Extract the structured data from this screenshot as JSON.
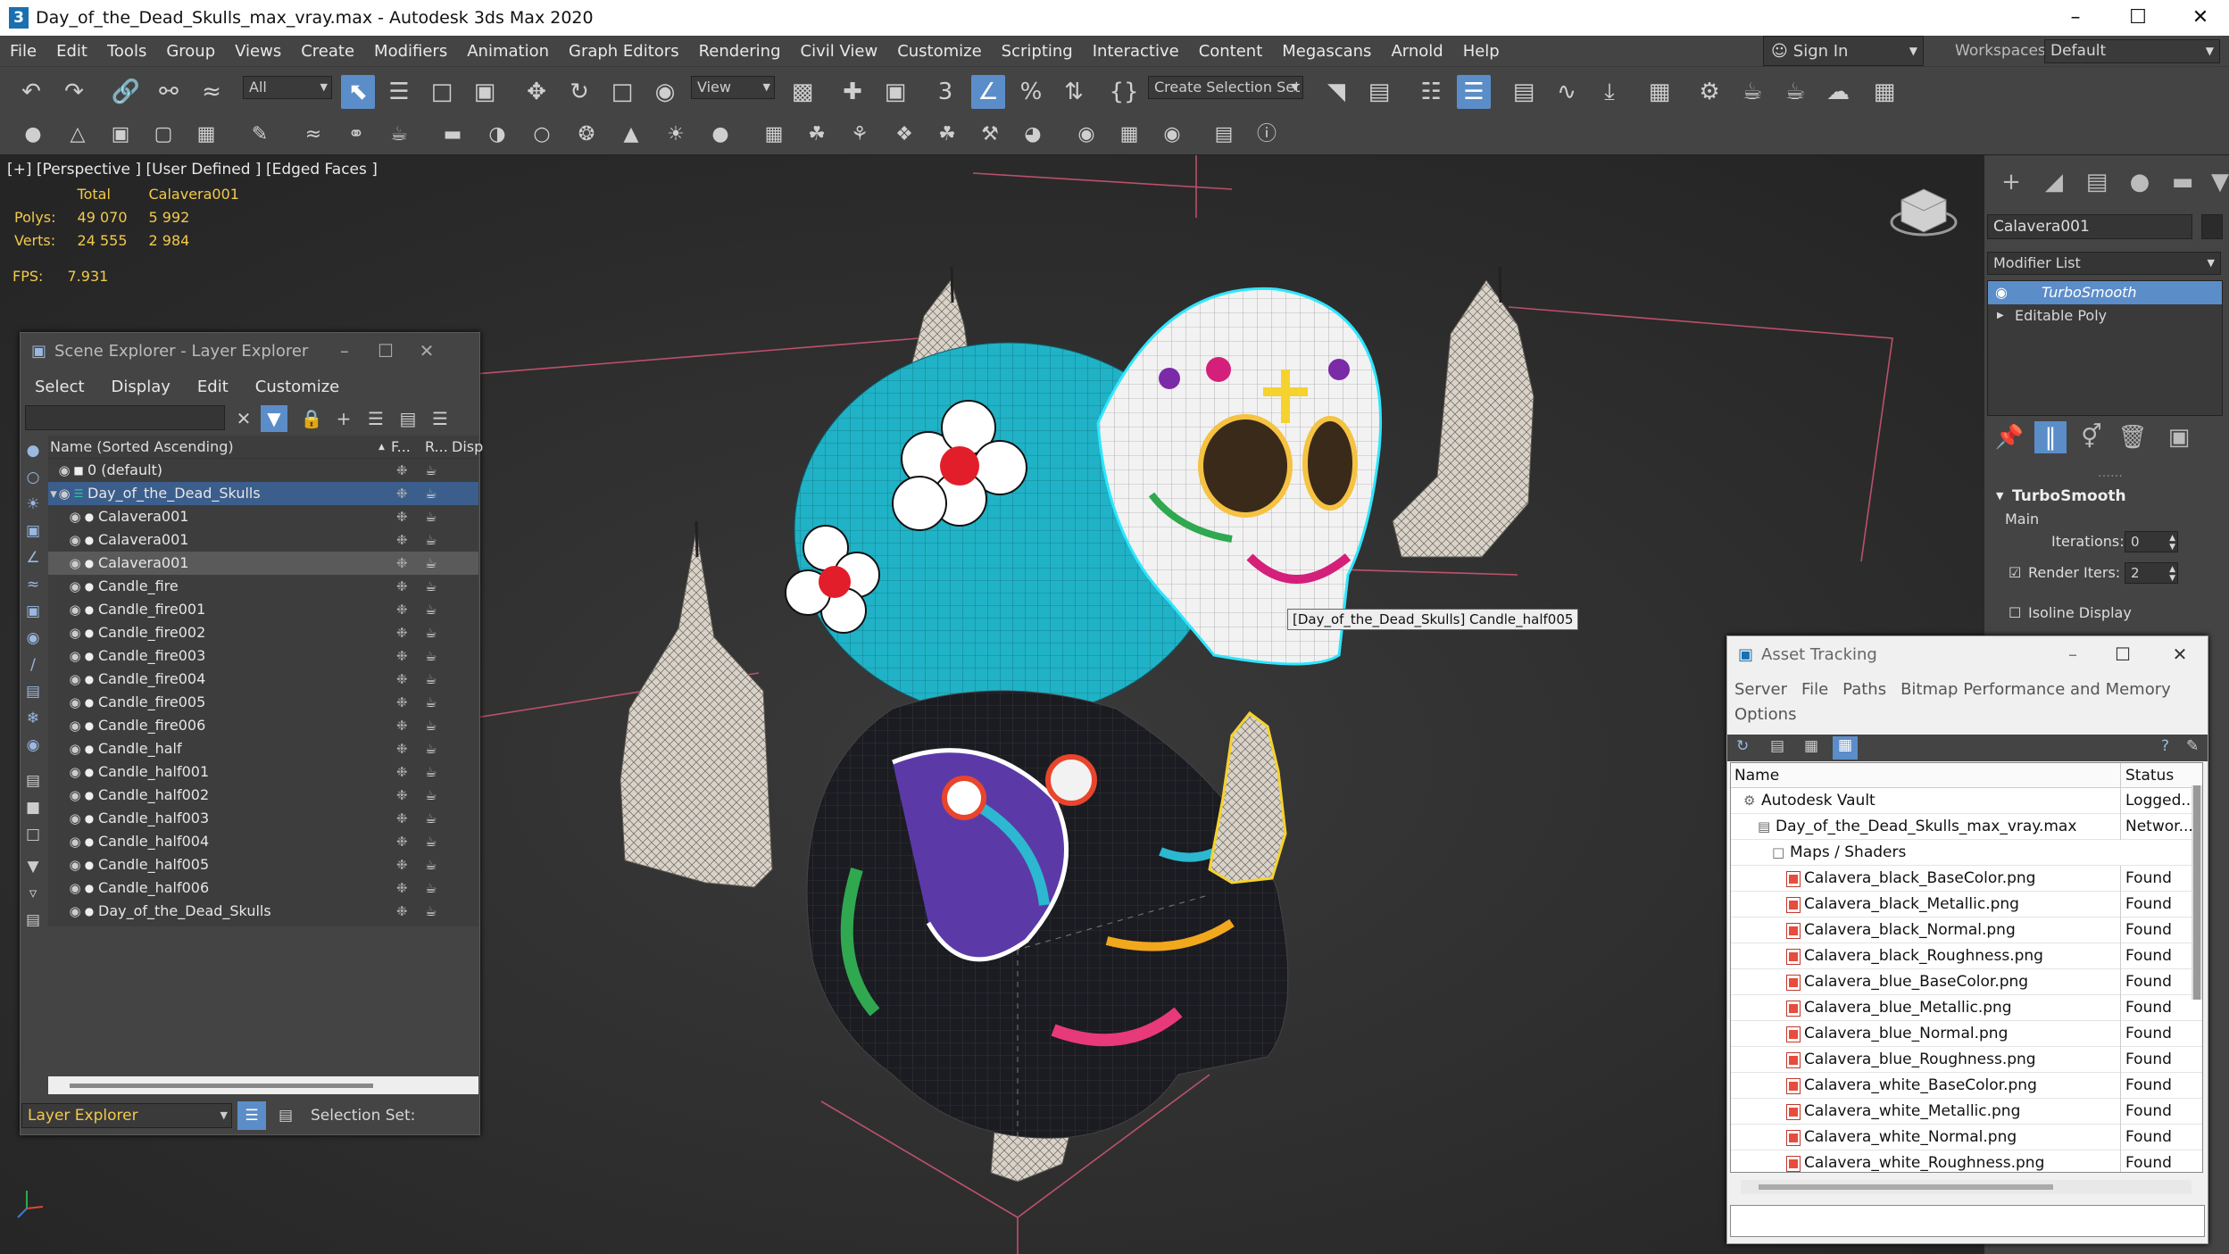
{
  "window": {
    "title": "Day_of_the_Dead_Skulls_max_vray.max - Autodesk 3ds Max 2020",
    "app_icon": "3ds-max-logo"
  },
  "menus": [
    "File",
    "Edit",
    "Tools",
    "Group",
    "Views",
    "Create",
    "Modifiers",
    "Animation",
    "Graph Editors",
    "Rendering",
    "Civil View",
    "Customize",
    "Scripting",
    "Interactive",
    "Content",
    "Megascans",
    "Arnold",
    "Help"
  ],
  "account": {
    "sign_in": "Sign In",
    "workspaces_label": "Workspaces:",
    "workspace": "Default"
  },
  "toolbar": {
    "filter": "All",
    "ref_coord": "View",
    "selection_set": "Create Selection Set"
  },
  "viewport": {
    "label": "[+] [Perspective ] [User Defined ] [Edged Faces ]",
    "stats": {
      "col_total": "Total",
      "col_obj": "Calavera001",
      "polys_label": "Polys:",
      "polys_total": "49 070",
      "polys_obj": "5 992",
      "verts_label": "Verts:",
      "verts_total": "24 555",
      "verts_obj": "2 984",
      "fps_label": "FPS:",
      "fps": "7.931"
    },
    "tooltip": "[Day_of_the_Dead_Skulls] Candle_half005"
  },
  "command_panel": {
    "object_name": "Calavera001",
    "modifier_list": "Modifier List",
    "stack": [
      "TurboSmooth",
      "Editable Poly"
    ],
    "rollout": "TurboSmooth",
    "section": "Main",
    "iterations_label": "Iterations:",
    "iterations": "0",
    "render_iters_label": "Render Iters:",
    "render_iters": "2",
    "isoline_label": "Isoline Display"
  },
  "scene_explorer": {
    "title": "Scene Explorer - Layer Explorer",
    "menu": [
      "Select",
      "Display",
      "Edit",
      "Customize"
    ],
    "columns": {
      "name": "Name (Sorted Ascending)",
      "c1": "F...",
      "c2": "R...",
      "c3": "Disp"
    },
    "rows": [
      {
        "name": "0 (default)",
        "level": 0
      },
      {
        "name": "Day_of_the_Dead_Skulls",
        "level": 0
      },
      {
        "name": "Calavera001",
        "level": 1
      },
      {
        "name": "Calavera001",
        "level": 1
      },
      {
        "name": "Calavera001",
        "level": 1
      },
      {
        "name": "Candle_fire",
        "level": 1
      },
      {
        "name": "Candle_fire001",
        "level": 1
      },
      {
        "name": "Candle_fire002",
        "level": 1
      },
      {
        "name": "Candle_fire003",
        "level": 1
      },
      {
        "name": "Candle_fire004",
        "level": 1
      },
      {
        "name": "Candle_fire005",
        "level": 1
      },
      {
        "name": "Candle_fire006",
        "level": 1
      },
      {
        "name": "Candle_half",
        "level": 1
      },
      {
        "name": "Candle_half001",
        "level": 1
      },
      {
        "name": "Candle_half002",
        "level": 1
      },
      {
        "name": "Candle_half003",
        "level": 1
      },
      {
        "name": "Candle_half004",
        "level": 1
      },
      {
        "name": "Candle_half005",
        "level": 1
      },
      {
        "name": "Candle_half006",
        "level": 1
      },
      {
        "name": "Day_of_the_Dead_Skulls",
        "level": 1
      }
    ],
    "footer": {
      "mode": "Layer Explorer",
      "selection_set_label": "Selection Set:"
    }
  },
  "asset_tracking": {
    "title": "Asset Tracking",
    "menu": [
      "Server",
      "File",
      "Paths",
      "Bitmap Performance and Memory",
      "Options"
    ],
    "columns": {
      "name": "Name",
      "status": "Status"
    },
    "rows": [
      {
        "name": "Autodesk Vault",
        "status": "Logged..."
      },
      {
        "name": "Day_of_the_Dead_Skulls_max_vray.max",
        "status": "Networ..."
      },
      {
        "name": "Maps / Shaders",
        "status": ""
      },
      {
        "name": "Calavera_black_BaseColor.png",
        "status": "Found"
      },
      {
        "name": "Calavera_black_Metallic.png",
        "status": "Found"
      },
      {
        "name": "Calavera_black_Normal.png",
        "status": "Found"
      },
      {
        "name": "Calavera_black_Roughness.png",
        "status": "Found"
      },
      {
        "name": "Calavera_blue_BaseColor.png",
        "status": "Found"
      },
      {
        "name": "Calavera_blue_Metallic.png",
        "status": "Found"
      },
      {
        "name": "Calavera_blue_Normal.png",
        "status": "Found"
      },
      {
        "name": "Calavera_blue_Roughness.png",
        "status": "Found"
      },
      {
        "name": "Calavera_white_BaseColor.png",
        "status": "Found"
      },
      {
        "name": "Calavera_white_Metallic.png",
        "status": "Found"
      },
      {
        "name": "Calavera_white_Normal.png",
        "status": "Found"
      },
      {
        "name": "Calavera_white_Roughness.png",
        "status": "Found"
      }
    ]
  },
  "colors": {
    "accent": "#5b8dc9",
    "stats_text": "#f2c94c",
    "selection_cyan": "#2ee6ff",
    "selection_yellow": "#f5d22e",
    "grid_pink": "#e05a7a"
  }
}
